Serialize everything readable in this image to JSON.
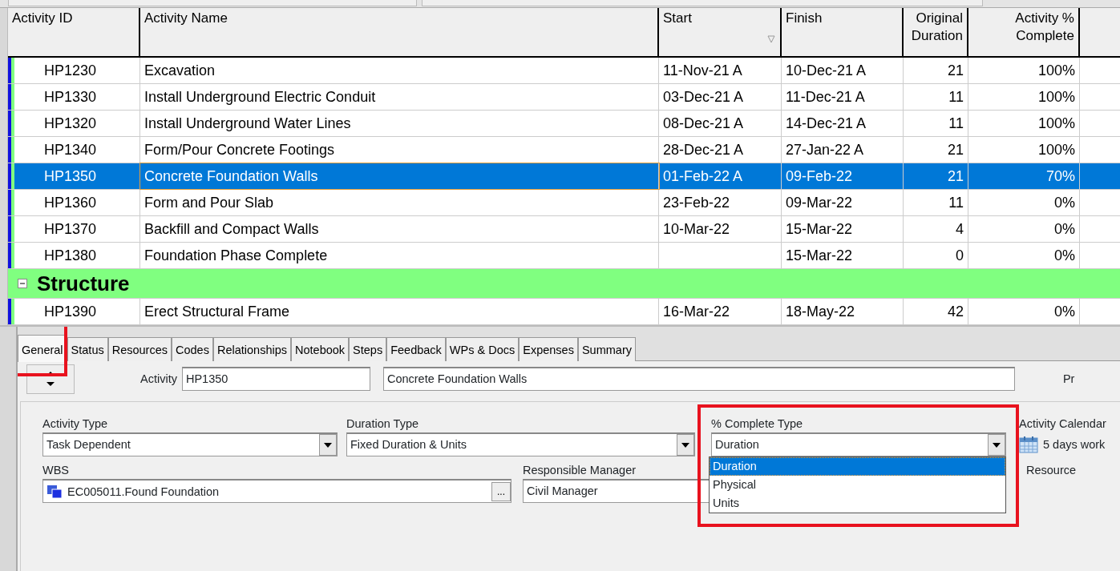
{
  "table": {
    "columns": [
      {
        "label": "Activity ID"
      },
      {
        "label": "Activity Name"
      },
      {
        "label": "Start",
        "sorted": true
      },
      {
        "label": "Finish"
      },
      {
        "label": "Original Duration"
      },
      {
        "label": "Activity % Complete"
      }
    ],
    "rows": [
      {
        "kind": "activity",
        "selected": false,
        "cells": [
          "HP1230",
          "Excavation",
          "11-Nov-21 A",
          "10-Dec-21 A",
          "21",
          "100%"
        ]
      },
      {
        "kind": "activity",
        "selected": false,
        "cells": [
          "HP1330",
          "Install Underground Electric Conduit",
          "03-Dec-21 A",
          "11-Dec-21 A",
          "11",
          "100%"
        ]
      },
      {
        "kind": "activity",
        "selected": false,
        "cells": [
          "HP1320",
          "Install Underground Water Lines",
          "08-Dec-21 A",
          "14-Dec-21 A",
          "11",
          "100%"
        ]
      },
      {
        "kind": "activity",
        "selected": false,
        "cells": [
          "HP1340",
          "Form/Pour Concrete Footings",
          "28-Dec-21 A",
          "27-Jan-22 A",
          "21",
          "100%"
        ]
      },
      {
        "kind": "activity",
        "selected": true,
        "cells": [
          "HP1350",
          "Concrete Foundation Walls",
          "01-Feb-22 A",
          "09-Feb-22",
          "21",
          "70%"
        ]
      },
      {
        "kind": "activity",
        "selected": false,
        "cells": [
          "HP1360",
          "Form and Pour Slab",
          "23-Feb-22",
          "09-Mar-22",
          "11",
          "0%"
        ]
      },
      {
        "kind": "activity",
        "selected": false,
        "cells": [
          "HP1370",
          "Backfill and Compact Walls",
          "10-Mar-22",
          "15-Mar-22",
          "4",
          "0%"
        ]
      },
      {
        "kind": "activity",
        "selected": false,
        "cells": [
          "HP1380",
          "Foundation Phase Complete",
          "",
          "15-Mar-22",
          "0",
          "0%"
        ]
      },
      {
        "kind": "group",
        "expanded": true,
        "title": "Structure"
      },
      {
        "kind": "activity",
        "selected": false,
        "cells": [
          "HP1390",
          "Erect Structural Frame",
          "16-Mar-22",
          "18-May-22",
          "42",
          "0%"
        ]
      }
    ]
  },
  "tabs": [
    {
      "label": "General",
      "selected": true
    },
    {
      "label": "Status",
      "selected": false
    },
    {
      "label": "Resources",
      "selected": false
    },
    {
      "label": "Codes",
      "selected": false
    },
    {
      "label": "Relationships",
      "selected": false
    },
    {
      "label": "Notebook",
      "selected": false
    },
    {
      "label": "Steps",
      "selected": false
    },
    {
      "label": "Feedback",
      "selected": false
    },
    {
      "label": "WPs & Docs",
      "selected": false
    },
    {
      "label": "Expenses",
      "selected": false
    },
    {
      "label": "Summary",
      "selected": false
    }
  ],
  "general": {
    "activity_label": "Activity",
    "activity_id": "HP1350",
    "activity_name": "Concrete Foundation Walls",
    "cut_label": "Pr",
    "activity_type": {
      "label": "Activity Type",
      "value": "Task Dependent"
    },
    "duration_type": {
      "label": "Duration Type",
      "value": "Fixed Duration & Units"
    },
    "percent_complete_type": {
      "label": "% Complete Type",
      "value": "Duration",
      "expanded": true,
      "options": [
        {
          "label": "Duration",
          "selected": true
        },
        {
          "label": "Physical",
          "selected": false
        },
        {
          "label": "Units",
          "selected": false
        }
      ]
    },
    "activity_calendar": {
      "label": "Activity Calendar",
      "value": "5 days work"
    },
    "wbs": {
      "label": "WBS",
      "value": "EC005011.Found  Foundation",
      "browse": "..."
    },
    "responsible_manager": {
      "label": "Responsible Manager",
      "value": "Civil Manager"
    },
    "resource": {
      "label": "Resource"
    }
  }
}
